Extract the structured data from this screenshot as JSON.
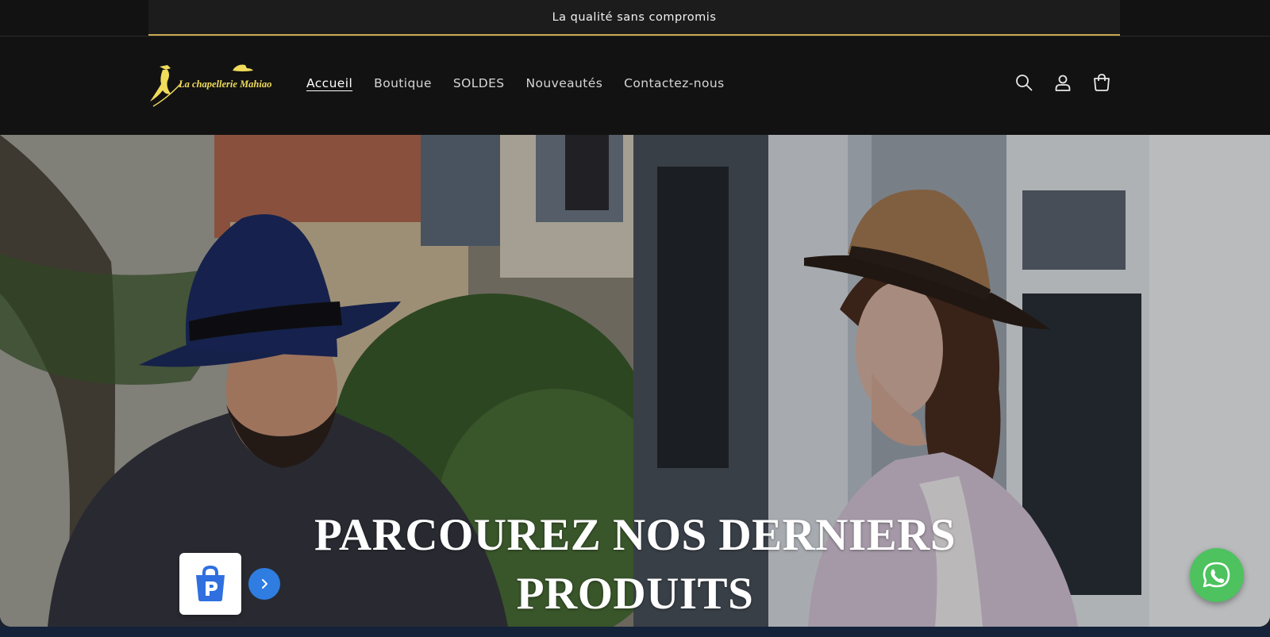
{
  "announcement": {
    "text": "La qualité sans compromis"
  },
  "header": {
    "logo_text": "La chapellerie Mahiaoui",
    "nav": [
      {
        "label": "Accueil",
        "active": true
      },
      {
        "label": "Boutique",
        "active": false
      },
      {
        "label": "SOLDES",
        "active": false
      },
      {
        "label": "Nouveautés",
        "active": false
      },
      {
        "label": "Contactez-nous",
        "active": false
      }
    ],
    "icons": [
      "search-icon",
      "account-icon",
      "cart-icon"
    ]
  },
  "hero": {
    "title_line1": "PARCOUREZ NOS DERNIERS",
    "title_line2": "PRODUITS"
  },
  "widgets": {
    "app_badge_icon": "shopping-bag-p-icon",
    "next_icon": "chevron-right-icon",
    "chat_icon": "whatsapp-icon"
  },
  "colors": {
    "header_bg": "#121212",
    "accent_gold": "#c9a94f",
    "whatsapp_green": "#4dc25e",
    "badge_blue": "#2f7de1"
  }
}
